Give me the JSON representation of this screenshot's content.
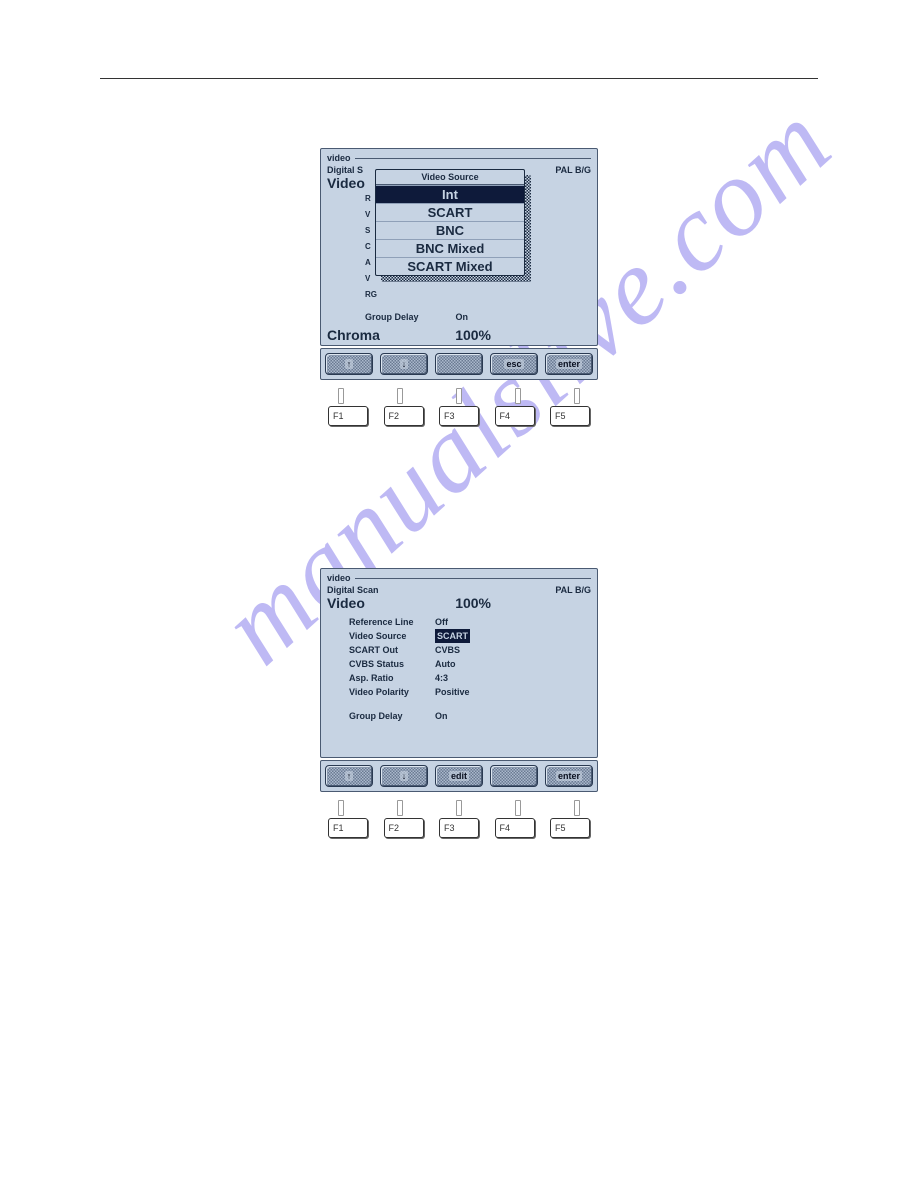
{
  "watermark": "manualslive.com",
  "screen1": {
    "panel_title": "video",
    "header_left": "Digital S",
    "header_right": "PAL B/G",
    "main_label": "Video",
    "truncated_rows": [
      "R",
      "V",
      "S",
      "C",
      "A",
      "V",
      "RG"
    ],
    "popup": {
      "title": "Video Source",
      "items": [
        "Int",
        "SCART",
        "BNC",
        "BNC Mixed",
        "SCART Mixed"
      ],
      "selected_index": 0
    },
    "footer_rows": [
      {
        "key": "Group Delay",
        "val": "On"
      }
    ],
    "chroma_label": "Chroma",
    "chroma_value": "100%",
    "softkeys": [
      "↑",
      "↓",
      "",
      "esc",
      "enter"
    ],
    "fkeys": [
      "F1",
      "F2",
      "F3",
      "F4",
      "F5"
    ]
  },
  "screen2": {
    "panel_title": "video",
    "header_left": "Digital Scan",
    "header_right": "PAL B/G",
    "main_label": "Video",
    "main_value": "100%",
    "settings": [
      {
        "key": "Reference Line",
        "val": "Off",
        "selected": false
      },
      {
        "key": "Video Source",
        "val": "SCART",
        "selected": true
      },
      {
        "key": "SCART Out",
        "val": "CVBS",
        "selected": false
      },
      {
        "key": "CVBS Status",
        "val": "Auto",
        "selected": false
      },
      {
        "key": "Asp. Ratio",
        "val": "4:3",
        "selected": false
      },
      {
        "key": "Video Polarity",
        "val": "Positive",
        "selected": false
      }
    ],
    "footer_rows": [
      {
        "key": "Group Delay",
        "val": "On"
      }
    ],
    "softkeys": [
      "↑",
      "↓",
      "edit",
      "",
      "enter"
    ],
    "fkeys": [
      "F1",
      "F2",
      "F3",
      "F4",
      "F5"
    ]
  }
}
